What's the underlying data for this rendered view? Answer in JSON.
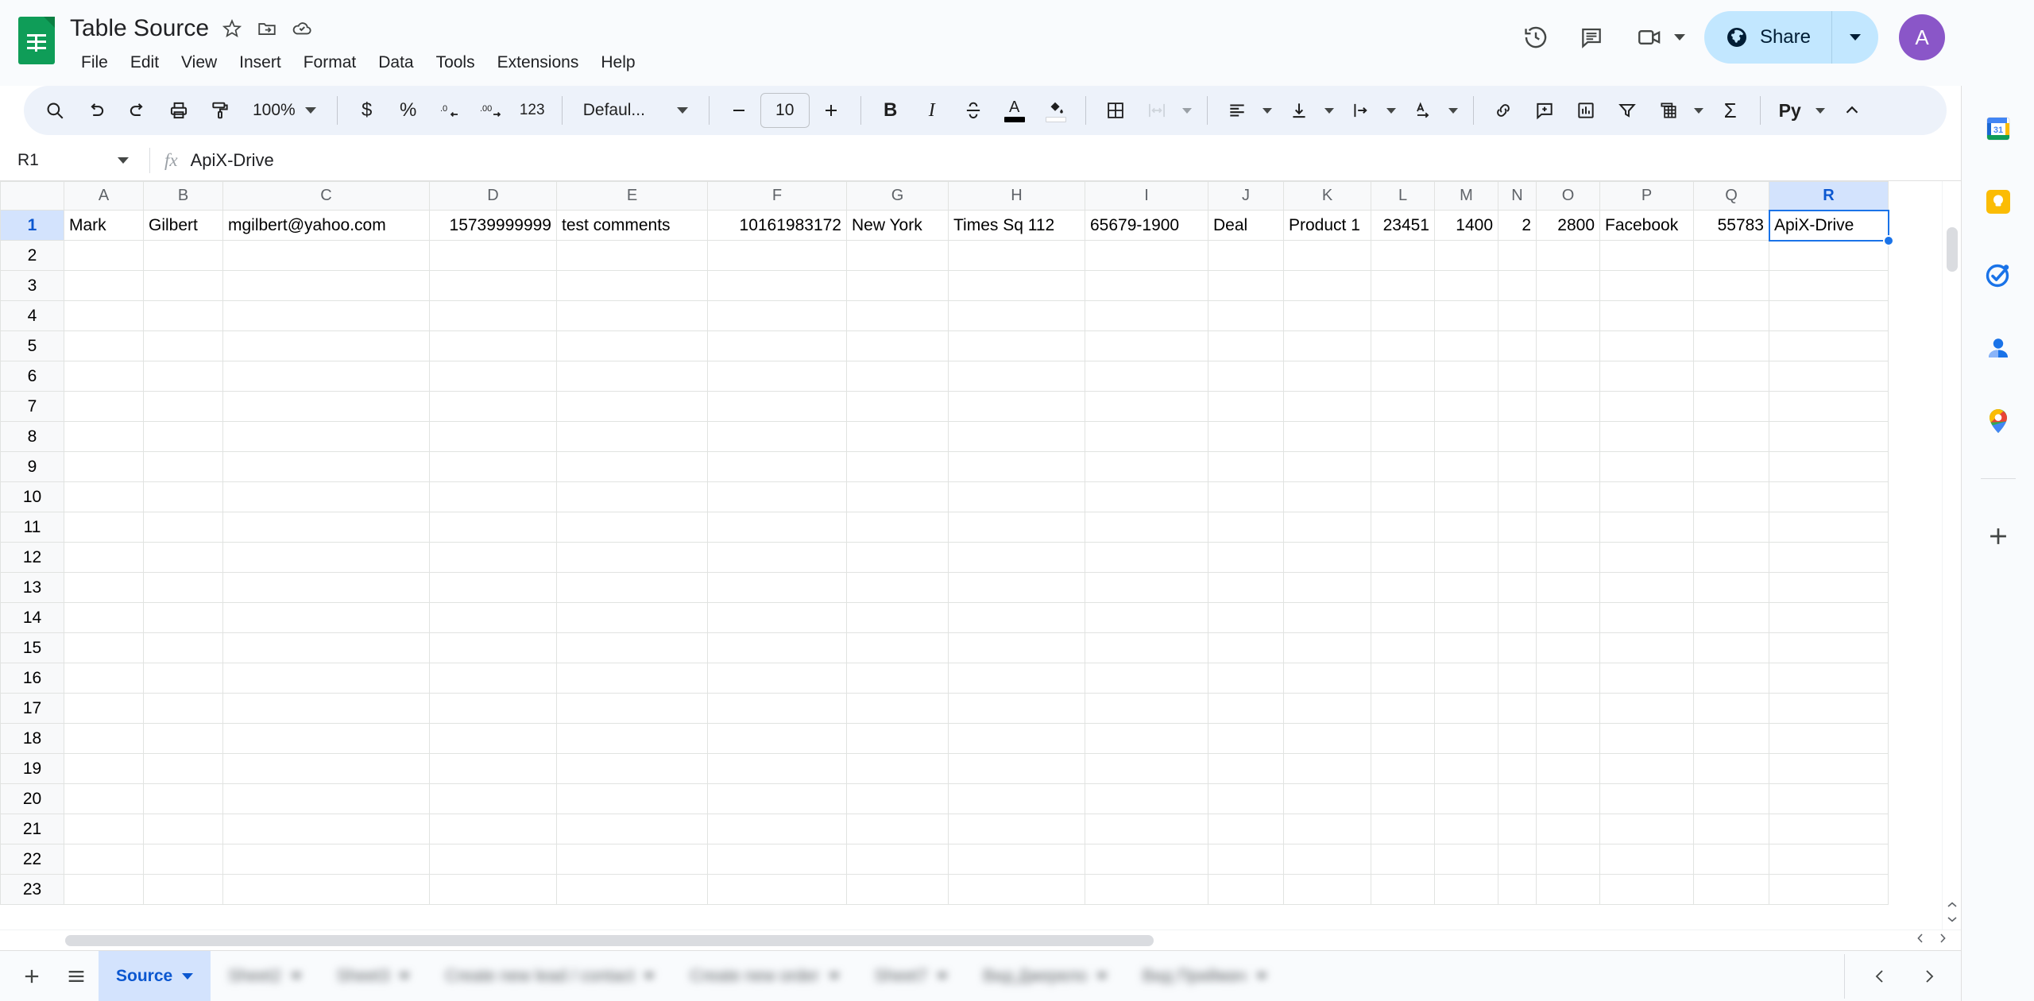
{
  "app": {
    "name": "Google Sheets",
    "logo_icon": "sheets-logo-icon",
    "doc_title": "Table Source",
    "star_icon": "star-icon",
    "move_icon": "move-to-folder-icon",
    "cloud_icon": "saved-to-drive-cloud-icon"
  },
  "menu": {
    "items": [
      {
        "label": "File"
      },
      {
        "label": "Edit"
      },
      {
        "label": "View"
      },
      {
        "label": "Insert"
      },
      {
        "label": "Format"
      },
      {
        "label": "Data"
      },
      {
        "label": "Tools"
      },
      {
        "label": "Extensions"
      },
      {
        "label": "Help"
      }
    ]
  },
  "header_right": {
    "history_icon": "version-history-icon",
    "comment_icon": "comment-icon",
    "meet_icon": "meet-camera-icon",
    "share_label": "Share",
    "share_globe_icon": "globe-icon",
    "share_bg": "#c2e7ff",
    "avatar_letter": "A",
    "avatar_bg": "#8a56c8"
  },
  "toolbar": {
    "zoom_value": "100%",
    "font_name": "Defaul...",
    "font_size": "10",
    "decimal_decrease_label": ".0",
    "decimal_increase_label": ".00",
    "number_format_label": "123",
    "currency_label": "$",
    "percent_label": "%",
    "bold_label": "B",
    "italic_label": "I",
    "strikethrough_label": "S",
    "text_color_label": "A",
    "text_color_swatch": "#000000",
    "fill_color_swatch": "#ffffff",
    "sum_label": "Σ",
    "py_label": "Py",
    "buttons": [
      {
        "name": "search-icon",
        "label": "Search"
      },
      {
        "name": "undo-icon",
        "label": "Undo"
      },
      {
        "name": "redo-icon",
        "label": "Redo"
      },
      {
        "name": "print-icon",
        "label": "Print"
      },
      {
        "name": "paint-format-icon",
        "label": "Paint format"
      },
      {
        "name": "borders-icon",
        "label": "Borders"
      },
      {
        "name": "merge-cells-icon",
        "label": "Merge cells"
      },
      {
        "name": "horizontal-align-icon",
        "label": "Horizontal align"
      },
      {
        "name": "vertical-align-icon",
        "label": "Vertical align"
      },
      {
        "name": "text-wrapping-icon",
        "label": "Text wrapping"
      },
      {
        "name": "text-rotation-icon",
        "label": "Text rotation"
      },
      {
        "name": "insert-link-icon",
        "label": "Insert link"
      },
      {
        "name": "insert-comment-icon",
        "label": "Insert comment"
      },
      {
        "name": "insert-chart-icon",
        "label": "Insert chart"
      },
      {
        "name": "create-filter-icon",
        "label": "Create a filter"
      },
      {
        "name": "pivot-table-icon",
        "label": "Pivot table"
      },
      {
        "name": "functions-icon",
        "label": "Functions"
      },
      {
        "name": "collapse-toolbar-icon",
        "label": "Collapse toolbar"
      }
    ]
  },
  "formula_bar": {
    "name_box": "R1",
    "fx_label": "fx",
    "value": "ApiX-Drive"
  },
  "grid": {
    "columns": [
      "A",
      "B",
      "C",
      "D",
      "E",
      "F",
      "G",
      "H",
      "I",
      "J",
      "K",
      "L",
      "M",
      "N",
      "O",
      "P",
      "Q",
      "R"
    ],
    "active_column": "R",
    "active_row": 1,
    "selected_cell": "R1",
    "row_count": 23,
    "rows": [
      {
        "num": "1",
        "cells": [
          {
            "col": "A",
            "value": "Mark",
            "align": "left"
          },
          {
            "col": "B",
            "value": "Gilbert",
            "align": "left"
          },
          {
            "col": "C",
            "value": "mgilbert@yahoo.com",
            "align": "left"
          },
          {
            "col": "D",
            "value": "15739999999",
            "align": "right"
          },
          {
            "col": "E",
            "value": "test comments",
            "align": "left"
          },
          {
            "col": "F",
            "value": "10161983172",
            "align": "right"
          },
          {
            "col": "G",
            "value": "New York",
            "align": "left"
          },
          {
            "col": "H",
            "value": "Times Sq 112",
            "align": "left"
          },
          {
            "col": "I",
            "value": "65679-1900",
            "align": "left"
          },
          {
            "col": "J",
            "value": "Deal",
            "align": "left"
          },
          {
            "col": "K",
            "value": "Product 1",
            "align": "left"
          },
          {
            "col": "L",
            "value": "23451",
            "align": "right"
          },
          {
            "col": "M",
            "value": "1400",
            "align": "right"
          },
          {
            "col": "N",
            "value": "2",
            "align": "right"
          },
          {
            "col": "O",
            "value": "2800",
            "align": "right"
          },
          {
            "col": "P",
            "value": "Facebook",
            "align": "left"
          },
          {
            "col": "Q",
            "value": "55783",
            "align": "right"
          },
          {
            "col": "R",
            "value": "ApiX-Drive",
            "align": "left"
          }
        ]
      }
    ]
  },
  "sheet_bar": {
    "add_icon": "add-sheet-icon",
    "all_sheets_icon": "all-sheets-icon",
    "prev_icon": "chevron-left-icon",
    "next_icon": "chevron-right-icon",
    "tabs": [
      {
        "label": "Source",
        "active": true,
        "blurred": false
      },
      {
        "label": "Sheet2",
        "active": false,
        "blurred": true
      },
      {
        "label": "Sheet3",
        "active": false,
        "blurred": true
      },
      {
        "label": "Create new lead / contact",
        "active": false,
        "blurred": true
      },
      {
        "label": "Create new order",
        "active": false,
        "blurred": true
      },
      {
        "label": "Sheet7",
        "active": false,
        "blurred": true
      },
      {
        "label": "Вид Джерело",
        "active": false,
        "blurred": true
      },
      {
        "label": "Вид Приймач",
        "active": false,
        "blurred": true
      }
    ]
  },
  "side_panel": {
    "items": [
      {
        "name": "google-calendar-icon",
        "label": "Calendar"
      },
      {
        "name": "google-keep-icon",
        "label": "Keep"
      },
      {
        "name": "google-tasks-icon",
        "label": "Tasks"
      },
      {
        "name": "google-contacts-icon",
        "label": "Contacts"
      },
      {
        "name": "google-maps-icon",
        "label": "Maps"
      },
      {
        "name": "add-addon-icon",
        "label": "Get Add-ons"
      }
    ]
  }
}
